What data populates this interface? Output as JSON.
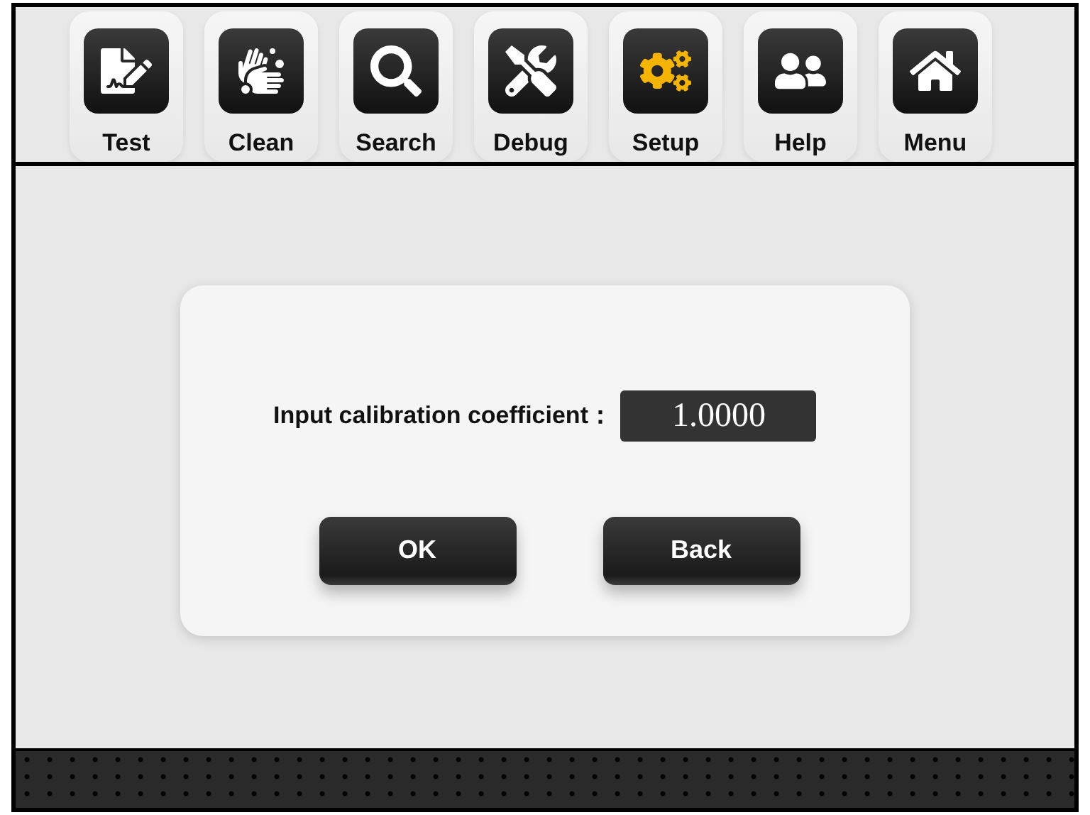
{
  "toolbar": [
    {
      "label": "Test",
      "kind": "document",
      "selected": false
    },
    {
      "label": "Clean",
      "kind": "washing",
      "selected": false
    },
    {
      "label": "Search",
      "kind": "magnifier",
      "selected": false
    },
    {
      "label": "Debug",
      "kind": "tools",
      "selected": false
    },
    {
      "label": "Setup",
      "kind": "gears",
      "selected": true
    },
    {
      "label": "Help",
      "kind": "people",
      "selected": false
    },
    {
      "label": "Menu",
      "kind": "house",
      "selected": false
    }
  ],
  "dialog": {
    "label": "Input calibration coefficient：",
    "value": "1.0000",
    "buttons": [
      "OK",
      "Back"
    ]
  }
}
